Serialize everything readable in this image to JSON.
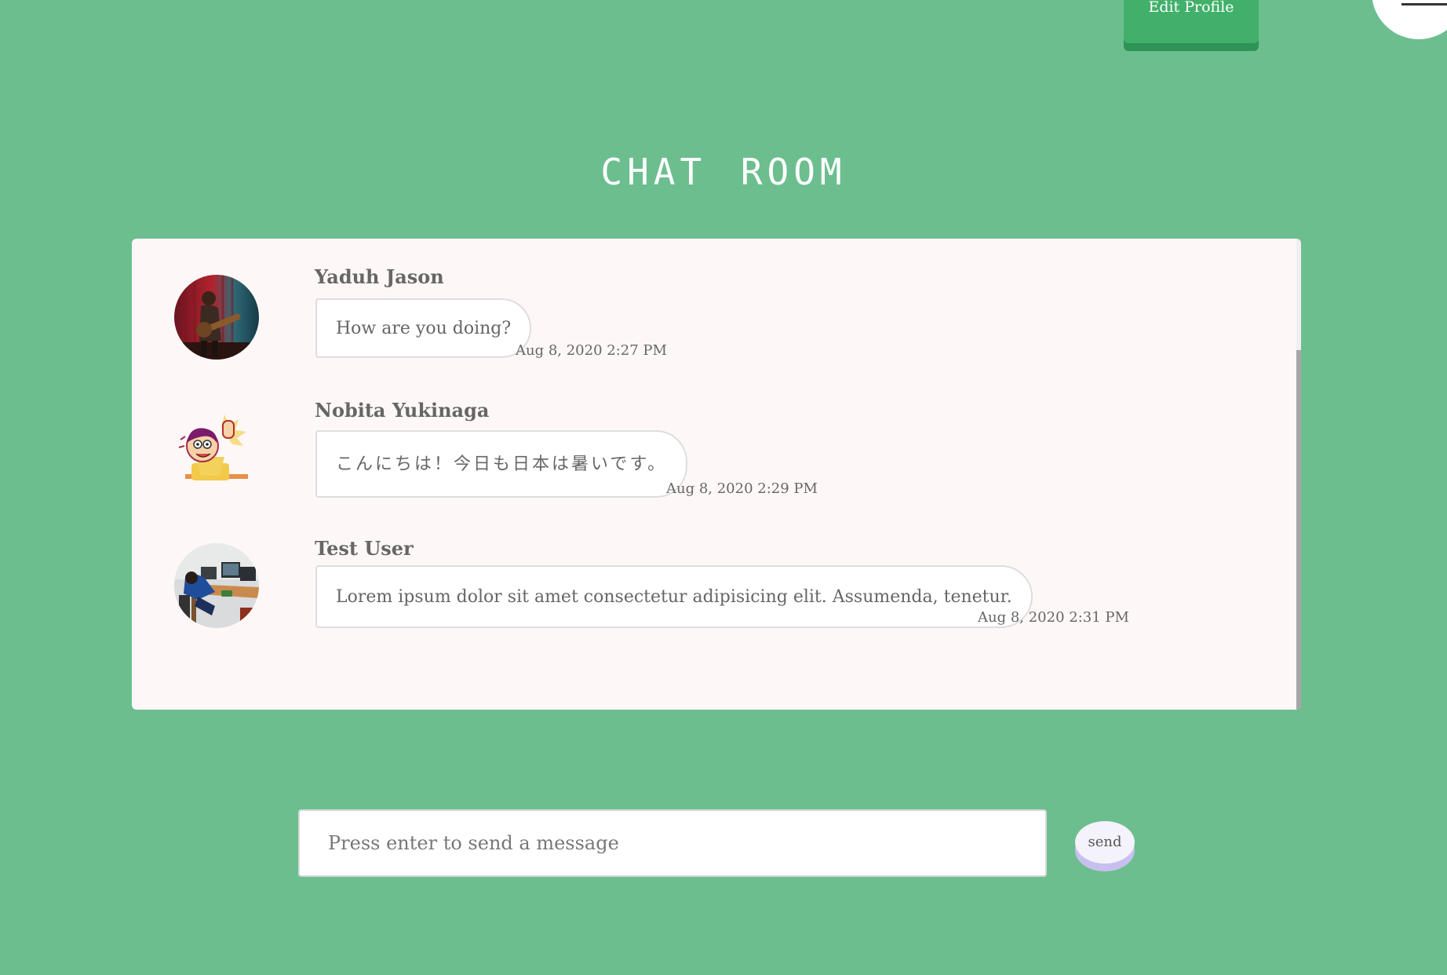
{
  "header": {
    "edit_profile_label": "Edit Profile",
    "menu_icon": "hamburger-menu-icon"
  },
  "page_title": "CHAT ROOM",
  "messages": [
    {
      "sender": "Yaduh Jason",
      "text": "How are you doing?",
      "time": "Aug 8, 2020 2:27 PM",
      "avatar": "photo of a guitarist on a red-lit stage"
    },
    {
      "sender": "Nobita Yukinaga",
      "text": "こんにちは！今日も日本は暑いです。",
      "time": "Aug 8, 2020 2:29 PM",
      "avatar": "cartoon boy waving hand"
    },
    {
      "sender": "Test User",
      "text": "Lorem ipsum dolor sit amet consectetur adipisicing elit. Assumenda, tenetur.",
      "time": "Aug 8, 2020 2:31 PM",
      "avatar": "photo of a person at a computer desk"
    }
  ],
  "composer": {
    "placeholder": "Press enter to send a message",
    "value": ""
  },
  "send_label": "send",
  "colors": {
    "page_background": "#6cbe8f",
    "edit_button": "#41b06a",
    "panel_background": "#fdf8f7",
    "text": "#666666",
    "send_shadow": "#c7c0ef"
  }
}
